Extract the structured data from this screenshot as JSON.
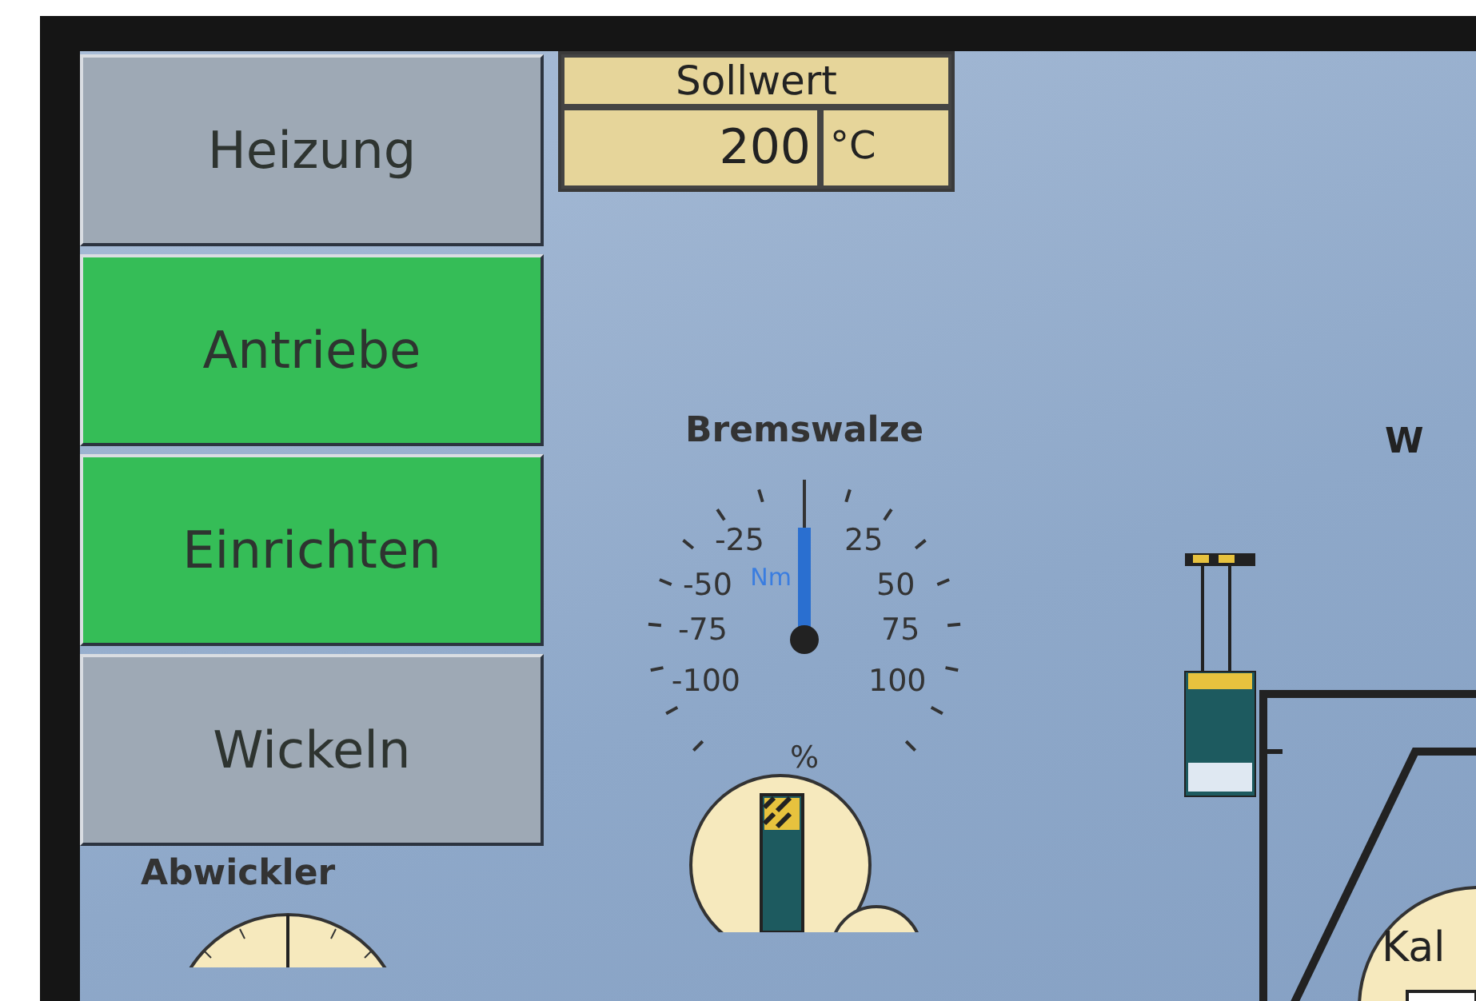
{
  "menu": [
    {
      "label": "Heizung",
      "active": false
    },
    {
      "label": "Antriebe",
      "active": true
    },
    {
      "label": "Einrichten",
      "active": true
    },
    {
      "label": "Wickeln",
      "active": false
    }
  ],
  "setpoint": {
    "label": "Sollwert",
    "value": "200",
    "unit": "°C"
  },
  "brake_roll": {
    "title": "Bremswalze",
    "level": 0.5,
    "unit": "Nm",
    "scale_unit": "%",
    "left_labels": [
      "-25",
      "-50",
      "-75",
      "-100"
    ],
    "right_labels": [
      "25",
      "50",
      "75",
      "100"
    ]
  },
  "unwinder": {
    "title": "Abwickler"
  },
  "machine": {
    "heading": "W",
    "roll_label": "Kal"
  }
}
